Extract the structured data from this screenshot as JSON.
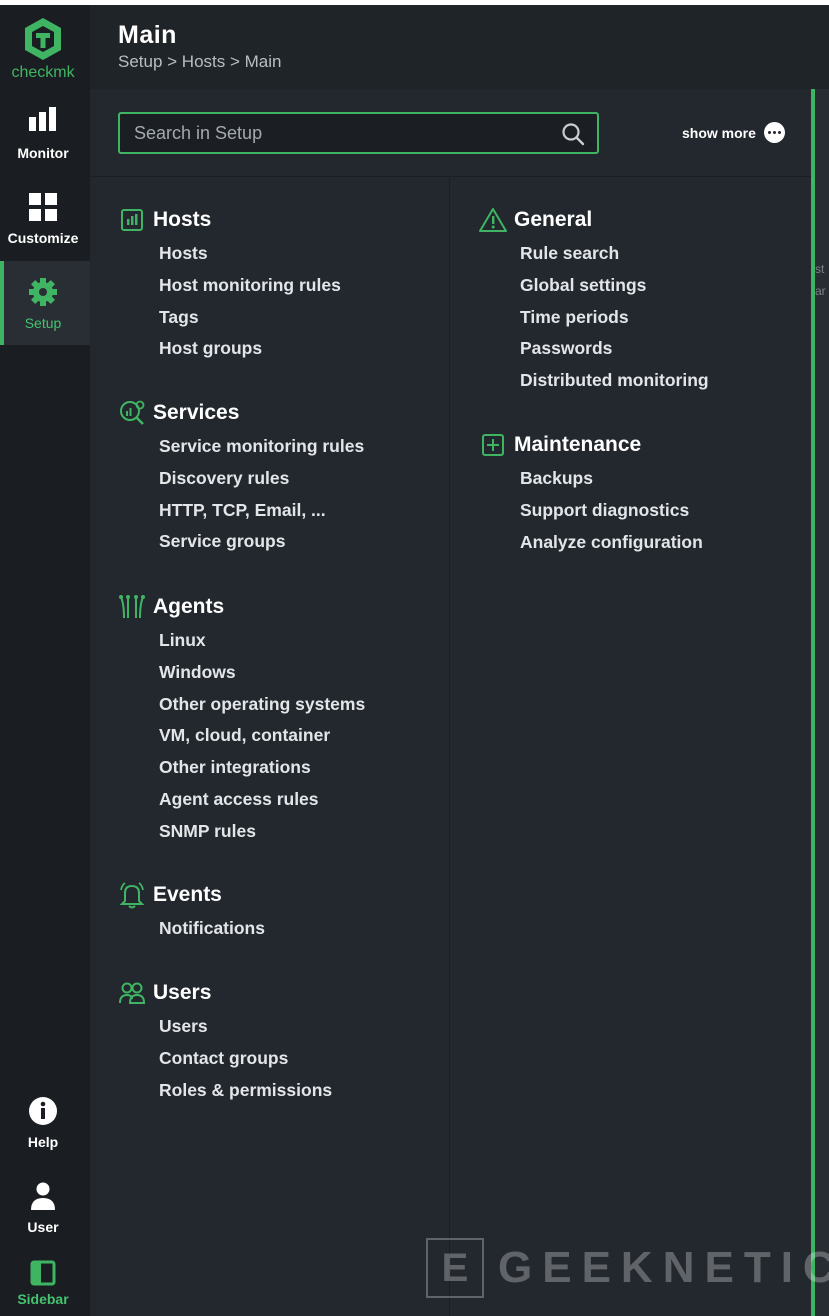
{
  "app": {
    "logo_text": "checkmk"
  },
  "nav": {
    "top": [
      {
        "label": "Monitor",
        "icon": "bar-chart-icon"
      },
      {
        "label": "Customize",
        "icon": "grid-icon"
      },
      {
        "label": "Setup",
        "icon": "gear-icon",
        "active": true
      }
    ],
    "bottom": [
      {
        "label": "Help",
        "icon": "info-icon"
      },
      {
        "label": "User",
        "icon": "user-icon"
      },
      {
        "label": "Sidebar",
        "icon": "sidebar-icon"
      }
    ]
  },
  "header": {
    "title": "Main",
    "breadcrumb": "Setup > Hosts > Main"
  },
  "search": {
    "placeholder": "Search in Setup"
  },
  "show_more": {
    "label": "show more"
  },
  "sections_left": [
    {
      "title": "Hosts",
      "icon": "hosts-icon",
      "items": [
        "Hosts",
        "Host monitoring rules",
        "Tags",
        "Host groups"
      ]
    },
    {
      "title": "Services",
      "icon": "services-icon",
      "items": [
        "Service monitoring rules",
        "Discovery rules",
        "HTTP, TCP, Email, ...",
        "Service groups"
      ]
    },
    {
      "title": "Agents",
      "icon": "agents-icon",
      "items": [
        "Linux",
        "Windows",
        "Other operating systems",
        "VM, cloud, container",
        "Other integrations",
        "Agent access rules",
        "SNMP rules"
      ]
    },
    {
      "title": "Events",
      "icon": "bell-icon",
      "items": [
        "Notifications"
      ]
    },
    {
      "title": "Users",
      "icon": "users-icon",
      "items": [
        "Users",
        "Contact groups",
        "Roles & permissions"
      ]
    }
  ],
  "sections_right": [
    {
      "title": "General",
      "icon": "warning-icon",
      "items": [
        "Rule search",
        "Global settings",
        "Time periods",
        "Passwords",
        "Distributed monitoring"
      ]
    },
    {
      "title": "Maintenance",
      "icon": "plus-box-icon",
      "items": [
        "Backups",
        "Support diagnostics",
        "Analyze configuration"
      ]
    }
  ],
  "right_strip": {
    "line1": "st",
    "line2": "ar"
  },
  "watermark": {
    "box_letter": "E",
    "text": "GEEKNETIC"
  },
  "colors": {
    "accent": "#3fb563",
    "background": "#23282e",
    "nav_bg": "#1a1e22"
  }
}
